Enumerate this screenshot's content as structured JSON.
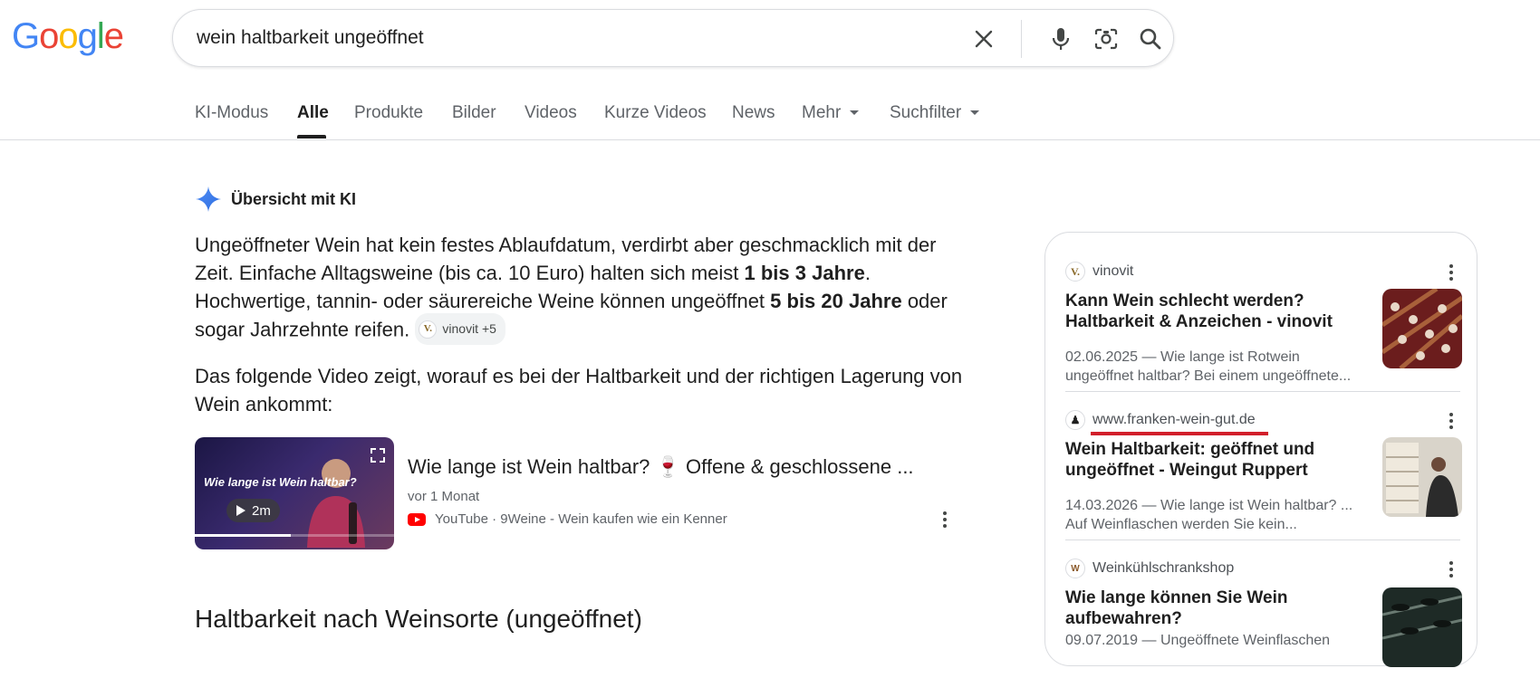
{
  "logo": {
    "letters": [
      "G",
      "o",
      "o",
      "g",
      "l",
      "e"
    ],
    "colors": [
      "#4285F4",
      "#EA4335",
      "#FBBC05",
      "#4285F4",
      "#34A853",
      "#EA4335"
    ]
  },
  "search": {
    "query": "wein haltbarkeit ungeöffnet"
  },
  "tabs": [
    {
      "label": "KI-Modus",
      "active": false
    },
    {
      "label": "Alle",
      "active": true
    },
    {
      "label": "Produkte",
      "active": false
    },
    {
      "label": "Bilder",
      "active": false
    },
    {
      "label": "Videos",
      "active": false
    },
    {
      "label": "Kurze Videos",
      "active": false
    },
    {
      "label": "News",
      "active": false
    },
    {
      "label": "Mehr",
      "active": false
    },
    {
      "label": "Suchfilter",
      "active": false
    }
  ],
  "ai_overview": {
    "title": "Übersicht mit KI",
    "para1_a": "Ungeöffneter Wein hat kein festes Ablaufdatum, verdirbt aber geschmacklich mit der Zeit. Einfache Alltagsweine (bis ca. 10 Euro) halten sich meist ",
    "para1_b": "1 bis 3 Jahre",
    "para1_c": ". Hochwertige, tannin- oder säurereiche Weine können ungeöffnet ",
    "para1_d": "5 bis 20 Jahre",
    "para1_e": " oder sogar Jahrzehnte reifen.",
    "chip_logo": "V.",
    "chip_label": "vinovit +5",
    "para2": "Das folgende Video zeigt, worauf es bei der Haltbarkeit und der richtigen Lagerung von Wein ankommt:"
  },
  "video": {
    "title": "Wie lange ist Wein haltbar? 🍷 Offene & geschlossene ...",
    "age": "vor 1 Monat",
    "source": "YouTube · 9Weine - Wein kaufen wie ein Kenner",
    "thumb_text": "Wie lange ist Wein haltbar?",
    "duration": "2m",
    "progress": 0.48
  },
  "section_heading": "Haltbarkeit nach Weinsorte (ungeöffnet)",
  "sources": [
    {
      "fav": "V.",
      "site": "vinovit",
      "title": "Kann Wein schlecht werden? Haltbarkeit & Anzeichen - vinovit",
      "snippet": "02.06.2025 — Wie lange ist Rotwein ungeöffnet haltbar? Bei einem ungeöffnete..."
    },
    {
      "fav": "♟",
      "site": "www.franken-wein-gut.de",
      "title": "Wein Haltbarkeit: geöffnet und ungeöffnet - Weingut Ruppert",
      "snippet": "14.03.2026 — Wie lange ist Wein haltbar? ... Auf Weinflaschen werden Sie kein..."
    },
    {
      "fav": "W",
      "site": "Weinkühlschrankshop",
      "title": "Wie lange können Sie Wein aufbewahren?",
      "snippet": "09.07.2019 — Ungeöffnete Weinflaschen"
    }
  ]
}
